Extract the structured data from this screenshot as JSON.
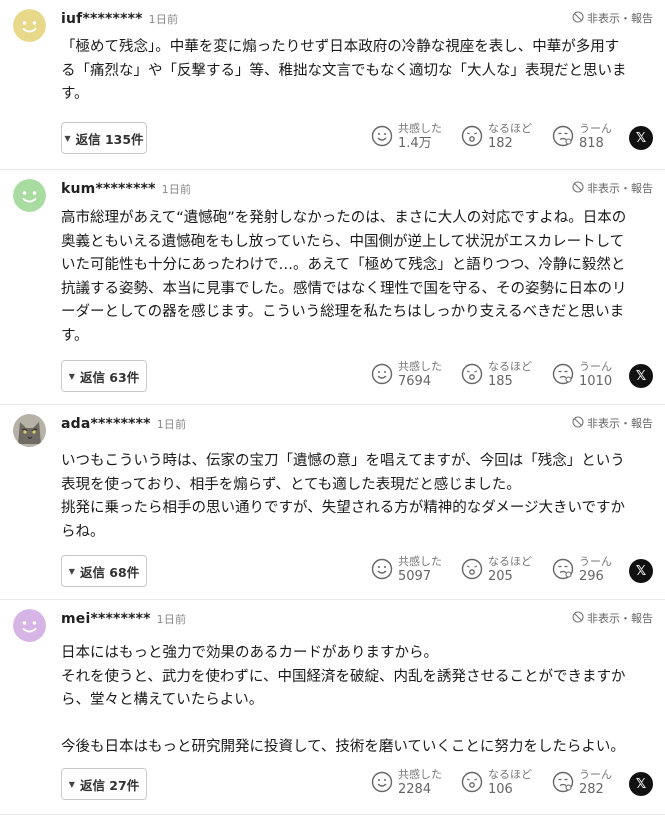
{
  "hide_report_label": "非表示・報告",
  "reactions": {
    "empathy": "共感した",
    "insight": "なるほど",
    "hmm": "うーん"
  },
  "share_x_label": "𝕏",
  "comments": [
    {
      "user": "iuf********",
      "time": "1日前",
      "avatar_color": "#e8d88a",
      "lines": [
        "「極めて残念」。中華を変に煽ったりせず日本政府の冷静な視座を表し、中華が多用す",
        "る「痛烈な」や「反撃する」等、稚拙な文言でもなく適切な「大人な」表現だと思いま",
        "す。"
      ],
      "reply_label": "返信 135件",
      "empathy": "1.4万",
      "insight": "182",
      "hmm": "818"
    },
    {
      "user": "kum********",
      "time": "1日前",
      "avatar_color": "#a8dca0",
      "lines": [
        "高市総理があえて“遺憾砲”を発射しなかったのは、まさに大人の対応ですよね。日本の",
        "奥義ともいえる遺憾砲をもし放っていたら、中国側が逆上して状況がエスカレートして",
        "いた可能性も十分にあったわけで…。あえて「極めて残念」と語りつつ、冷静に毅然と",
        "抗議する姿勢、本当に見事でした。感情ではなく理性で国を守る、その姿勢に日本のリ",
        "ーダーとしての器を感じます。こういう総理を私たちはしっかり支えるべきだと思いま",
        "す。"
      ],
      "reply_label": "返信 63件",
      "empathy": "7694",
      "insight": "185",
      "hmm": "1010"
    },
    {
      "user": "ada********",
      "time": "1日前",
      "avatar_color": "#8a8a8a",
      "lines": [
        "いつもこういう時は、伝家の宝刀「遺憾の意」を唱えてますが、今回は「残念」という",
        "表現を使っており、相手を煽らず、とても適した表現だと感じました。",
        "挑発に乗ったら相手の思い通りですが、失望される方が精神的なダメージ大きいですか",
        "らね。"
      ],
      "reply_label": "返信 68件",
      "empathy": "5097",
      "insight": "205",
      "hmm": "296"
    },
    {
      "user": "mei********",
      "time": "1日前",
      "avatar_color": "#d6b4e6",
      "lines": [
        "日本にはもっと強力で効果のあるカードがありますから。",
        "それを使うと、武力を使わずに、中国経済を破綻、内乱を誘発させることができますか",
        "ら、堂々と構えていたらよい。",
        "",
        "今後も日本はもっと研究開発に投資して、技術を磨いていくことに努力をしたらよい。"
      ],
      "reply_label": "返信 27件",
      "empathy": "2284",
      "insight": "106",
      "hmm": "282"
    }
  ]
}
